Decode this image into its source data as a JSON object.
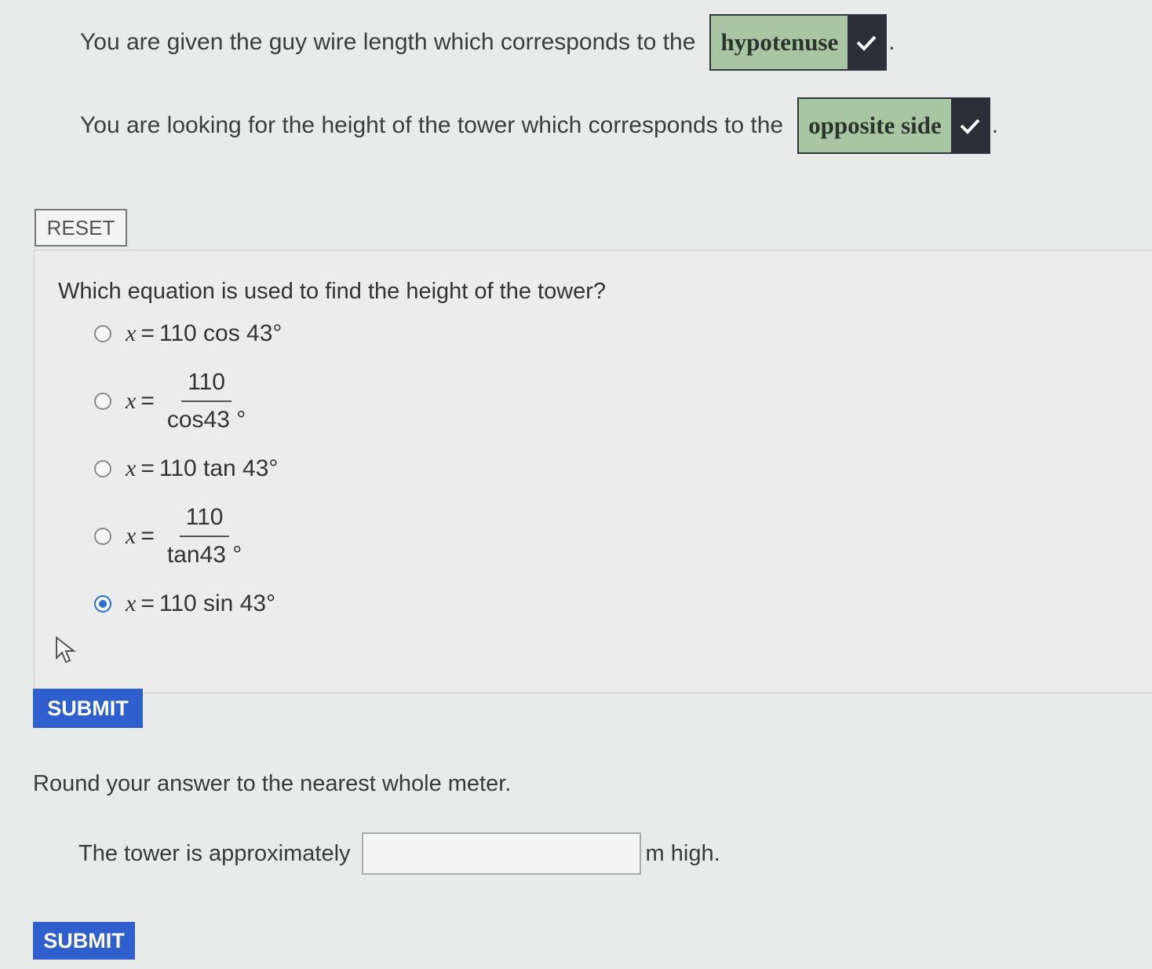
{
  "statements": [
    {
      "text": "You are given the guy wire length which corresponds to the",
      "answer": "hypotenuse",
      "end": "."
    },
    {
      "text": "You are looking for the height of the tower which corresponds to the",
      "answer": "opposite side",
      "end": "."
    }
  ],
  "reset_label": "RESET",
  "question": "Which equation is used to find the height of the tower?",
  "options": [
    {
      "var": "x",
      "eq": "=",
      "expr": "110 cos 43°",
      "selected": false
    },
    {
      "var": "x",
      "eq": "=",
      "numerator": "110",
      "denominator": "cos43 °",
      "selected": false
    },
    {
      "var": "x",
      "eq": "=",
      "expr": "110 tan 43°",
      "selected": false
    },
    {
      "var": "x",
      "eq": "=",
      "numerator": "110",
      "denominator": "tan43 °",
      "selected": false
    },
    {
      "var": "x",
      "eq": "=",
      "expr": "110 sin 43°",
      "selected": true
    }
  ],
  "submit_label_1": "SUBMIT",
  "round_text": "Round your answer to the nearest whole meter.",
  "tower_prefix": "The tower is approximately",
  "tower_suffix": "m high.",
  "tower_value": "",
  "submit_label_2": "SUBMIT",
  "colors": {
    "accent": "#2f5fcc",
    "answer_bg": "#a9c6a3",
    "check_bg": "#2b3038"
  }
}
